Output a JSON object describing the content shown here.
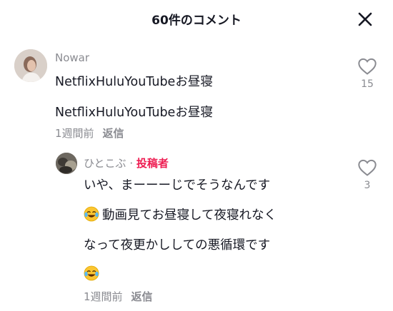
{
  "header": {
    "title": "60件のコメント"
  },
  "comments": [
    {
      "username": "Nowar",
      "lines": [
        "NetflixHuluYouTubeお昼寝",
        "NetflixHuluYouTubeお昼寝"
      ],
      "time": "1週間前",
      "reply_label": "返信",
      "likes": "15"
    },
    {
      "username": "ひとこぶ",
      "separator": "·",
      "badge": "投稿者",
      "lines": [
        "いや、まーーーじでそうなんです",
        "動画見てお昼寝して夜寝れなく",
        "なって夜更かししての悪循環です",
        ""
      ],
      "emoji": "face-with-tears-of-joy",
      "time": "1週間前",
      "reply_label": "返信",
      "likes": "3"
    }
  ]
}
